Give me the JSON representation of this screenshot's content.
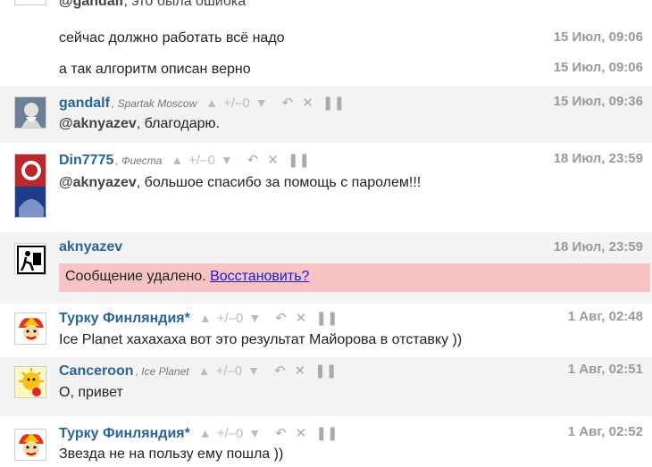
{
  "top_cut": {
    "mention": "@gandalf",
    "text": ", это была ошибка"
  },
  "standalone": [
    {
      "text": "сейчас должно работать всё надо",
      "time": "15 Июл, 09:06"
    },
    {
      "text": "а так алгоритм описан верно",
      "time": "15 Июл, 09:06"
    }
  ],
  "messages": [
    {
      "author": "gandalf",
      "team": "Spartak Moscow",
      "score": "0",
      "time": "15 Июл, 09:36",
      "mention": "@aknyazev",
      "text": ", благодарю.",
      "avatar": "gandalf-avatar"
    },
    {
      "author": "Din7775",
      "team": "Фиеста",
      "score": "0",
      "time": "18 Июл, 23:59",
      "mention": "@aknyazev",
      "text": ", большое спасибо за помощь с паролем!!!",
      "avatar": "cska-avatar"
    },
    {
      "author": "aknyazev",
      "time": "18 Июл, 23:59",
      "deleted_text": "Сообщение удалено. ",
      "restore_link": "Восстановить?",
      "avatar": "pictogram-avatar"
    },
    {
      "author": "Турку Финляндия*",
      "score": "0",
      "time": "1 Авг, 02:48",
      "text": "Ice Planet хахахаха вот это результат Майорова в отставку ))",
      "avatar": "jokerit-avatar"
    },
    {
      "author": "Canceroon",
      "team": "Ice Planet",
      "score": "0",
      "time": "1 Авг, 02:51",
      "text": "О, привет",
      "avatar": "sun-avatar"
    },
    {
      "author": "Турку Финляндия*",
      "score": "0",
      "time": "1 Авг, 02:52",
      "text": "Звезда не на пользу ему пошла ))",
      "avatar": "jokerit-avatar"
    }
  ],
  "controls": {
    "up": "▲",
    "plusminus": "+/–",
    "down": "▼",
    "reply": "↶",
    "delete": "✕",
    "pause": "❚❚"
  },
  "colors": {
    "author": "#2a6496",
    "deleted_bg": "#f7c3c3",
    "alt_row": "#f3f3f3"
  }
}
